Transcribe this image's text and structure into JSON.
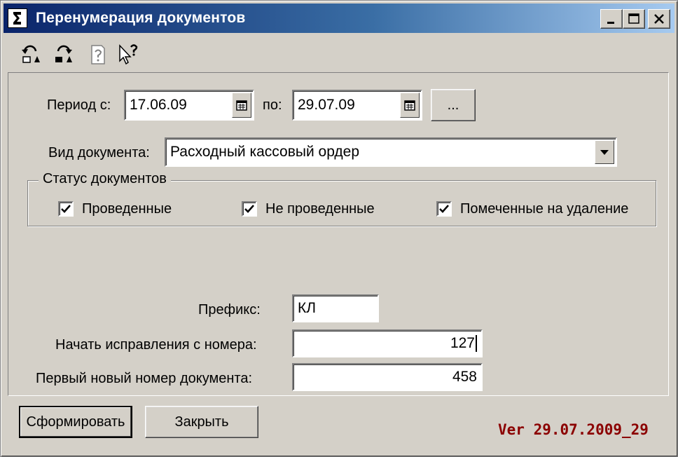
{
  "window": {
    "title": "Перенумерация документов",
    "controls": {
      "minimize": "minimize-icon",
      "maximize": "maximize-icon",
      "close": "close-icon"
    }
  },
  "toolbar": {
    "icons": [
      "undo-icon",
      "redo-icon",
      "help-page-icon",
      "context-help-icon"
    ]
  },
  "period": {
    "from_label": "Период с:",
    "from_value": "17.06.09",
    "to_label": "по:",
    "to_value": "29.07.09",
    "more_label": "..."
  },
  "doc_type": {
    "label": "Вид документа:",
    "value": "Расходный кассовый ордер"
  },
  "status": {
    "title": "Статус документов",
    "items": [
      {
        "label": "Проведенные",
        "checked": true
      },
      {
        "label": "Не проведенные",
        "checked": true
      },
      {
        "label": "Помеченные на удаление",
        "checked": true
      }
    ]
  },
  "prefix": {
    "label": "Префикс:",
    "value": "КЛ"
  },
  "start_from": {
    "label": "Начать исправления с номера:",
    "value": "127"
  },
  "first_new": {
    "label": "Первый новый номер документа:",
    "value": "458"
  },
  "buttons": {
    "generate": "Сформировать",
    "close": "Закрыть"
  },
  "version": "Ver 29.07.2009_29"
}
